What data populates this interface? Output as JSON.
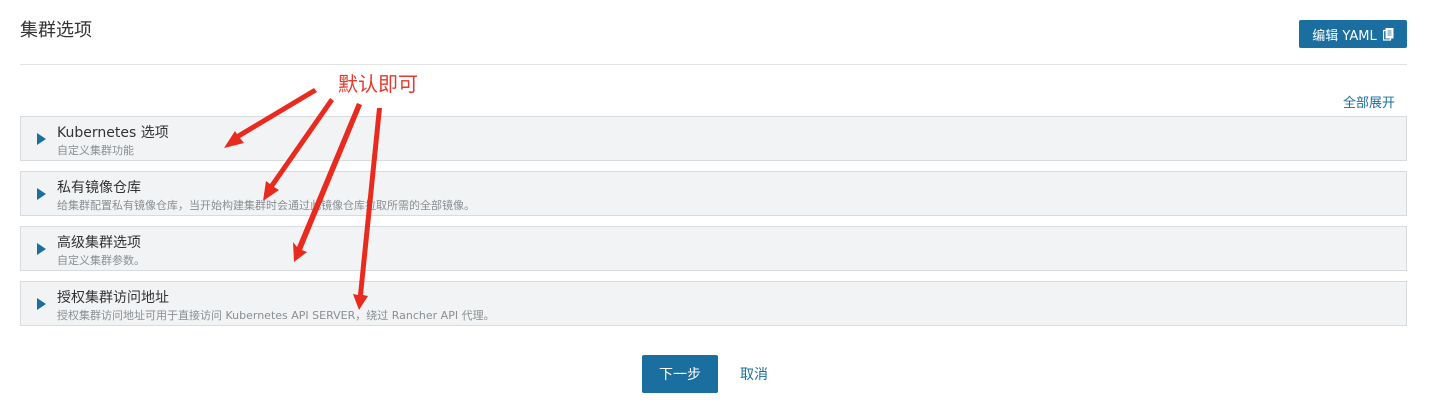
{
  "header": {
    "title": "集群选项",
    "edit_yaml_label": "编辑 YAML"
  },
  "annotation": "默认即可",
  "expand_all": "全部展开",
  "sections": [
    {
      "title": "Kubernetes 选项",
      "description": "自定义集群功能"
    },
    {
      "title": "私有镜像仓库",
      "description": "给集群配置私有镜像仓库，当开始构建集群时会通过此镜像仓库拉取所需的全部镜像。"
    },
    {
      "title": "高级集群选项",
      "description": "自定义集群参数。"
    },
    {
      "title": "授权集群访问地址",
      "description": "授权集群访问地址可用于直接访问 Kubernetes API SERVER，绕过 Rancher API 代理。"
    }
  ],
  "footer": {
    "next_label": "下一步",
    "cancel_label": "取消"
  },
  "colors": {
    "primary": "#1a6fa0",
    "annotation": "#e53a30",
    "section_bg": "#f1f3f4"
  },
  "icons": {
    "edit_yaml": "copy-icon",
    "section_toggle": "caret-right-icon"
  }
}
